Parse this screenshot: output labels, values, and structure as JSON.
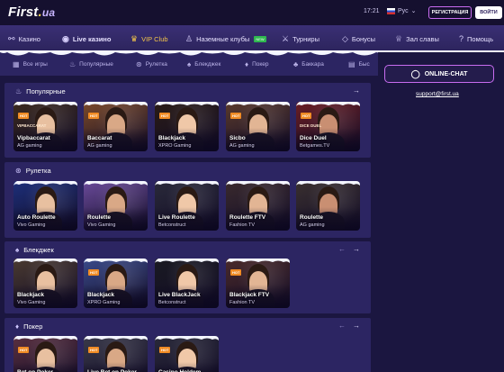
{
  "header": {
    "logo_main": "First",
    "logo_dot": ".",
    "logo_ua": "ua",
    "time": "17:21",
    "lang": "Рус",
    "register_label": "РЕГИСТРАЦИЯ",
    "login_label": "ВОЙТИ"
  },
  "nav": [
    {
      "label": "Казино",
      "icon": "casino-icon"
    },
    {
      "label": "Live казино",
      "icon": "live-casino-icon"
    },
    {
      "label": "VIP Club",
      "icon": "crown-icon"
    },
    {
      "label": "Наземные клубы",
      "icon": "person-icon",
      "badge": "NEW"
    },
    {
      "label": "Турниры",
      "icon": "swords-icon"
    },
    {
      "label": "Бонусы",
      "icon": "diamond-icon"
    },
    {
      "label": "Зал славы",
      "icon": "trophy-icon"
    },
    {
      "label": "Помощь",
      "icon": "help-icon"
    }
  ],
  "subnav": [
    {
      "label": "Все игры",
      "icon": "grid-icon"
    },
    {
      "label": "Популярные",
      "icon": "fire-icon"
    },
    {
      "label": "Рулетка",
      "icon": "roulette-icon"
    },
    {
      "label": "Блекджек",
      "icon": "blackjack-icon"
    },
    {
      "label": "Покер",
      "icon": "poker-icon"
    },
    {
      "label": "Баккара",
      "icon": "baccarat-icon"
    },
    {
      "label": "Быс",
      "icon": "fast-icon"
    }
  ],
  "sidebar": {
    "chat_label": "ONLINE-CHAT",
    "support_email": "support@first.ua"
  },
  "sections": [
    {
      "title": "Популярные",
      "icon": "fire-icon",
      "cards": [
        {
          "name": "Vipbaccarat",
          "provider": "AG gaming",
          "hot": "HOT",
          "tag": "VIPBACCARAT"
        },
        {
          "name": "Baccarat",
          "provider": "AG gaming",
          "hot": "HOT"
        },
        {
          "name": "Blackjack",
          "provider": "XPRO Gaming",
          "hot": "HOT"
        },
        {
          "name": "Sicbo",
          "provider": "AG gaming",
          "hot": "HOT"
        },
        {
          "name": "Dice Duel",
          "provider": "Betgames.TV",
          "hot": "HOT",
          "tag": "DICE DUEL"
        }
      ]
    },
    {
      "title": "Рулетка",
      "icon": "roulette-icon",
      "cards": [
        {
          "name": "Auto Roulette",
          "provider": "Vivo Gaming"
        },
        {
          "name": "Roulette",
          "provider": "Vivo Gaming"
        },
        {
          "name": "Live Roulette",
          "provider": "Betconstruct"
        },
        {
          "name": "Roulette FTV",
          "provider": "Fashion TV"
        },
        {
          "name": "Roulette",
          "provider": "AG gaming"
        }
      ]
    },
    {
      "title": "Блекджек",
      "icon": "blackjack-icon",
      "cards": [
        {
          "name": "Blackjack",
          "provider": "Vivo Gaming"
        },
        {
          "name": "Blackjack",
          "provider": "XPRO Gaming",
          "hot": "HOT"
        },
        {
          "name": "Live BlackJack",
          "provider": "Betconstruct"
        },
        {
          "name": "Blackjack FTV",
          "provider": "Fashion TV",
          "hot": "HOT"
        }
      ]
    },
    {
      "title": "Покер",
      "icon": "poker-icon",
      "cards": [
        {
          "name": "Bet on Poker",
          "provider": "",
          "hot": "HOT"
        },
        {
          "name": "Live Bet on Poker",
          "provider": "",
          "hot": "HOT"
        },
        {
          "name": "Casino Holdem",
          "provider": "",
          "hot": "HOT"
        }
      ]
    }
  ],
  "colors": {
    "background": "#1b1640",
    "panel": "#2c2562",
    "nav": "#3a2f74",
    "accent_pink": "#c86cf0",
    "vip_gold": "#f2c44a",
    "hot_orange": "#f08b24"
  }
}
